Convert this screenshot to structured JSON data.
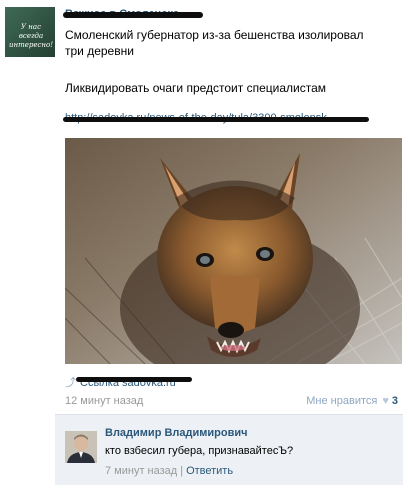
{
  "avatar": {
    "text": "У нас всегда интересно!"
  },
  "post": {
    "author": "Важное в Смоленске",
    "text1": "Смоленский губернатор из-за бешенства изолировал\nтри деревни",
    "text2": "Ликвидировать очаги предстоит специалистам",
    "link": "http://sadovka.ru/news-of-the-day/tula/3300-smolensk",
    "source_label": "Ссылка sadovka.ru",
    "time": "12 минут назад",
    "likes_label": "Мне нравится",
    "likes_count": "3"
  },
  "comment": {
    "name": "Владимир Владимирович",
    "text": "кто взбесил губера, признавайтесЪ?",
    "time": "7 минут назад",
    "sep": "|",
    "reply": "Ответить"
  }
}
